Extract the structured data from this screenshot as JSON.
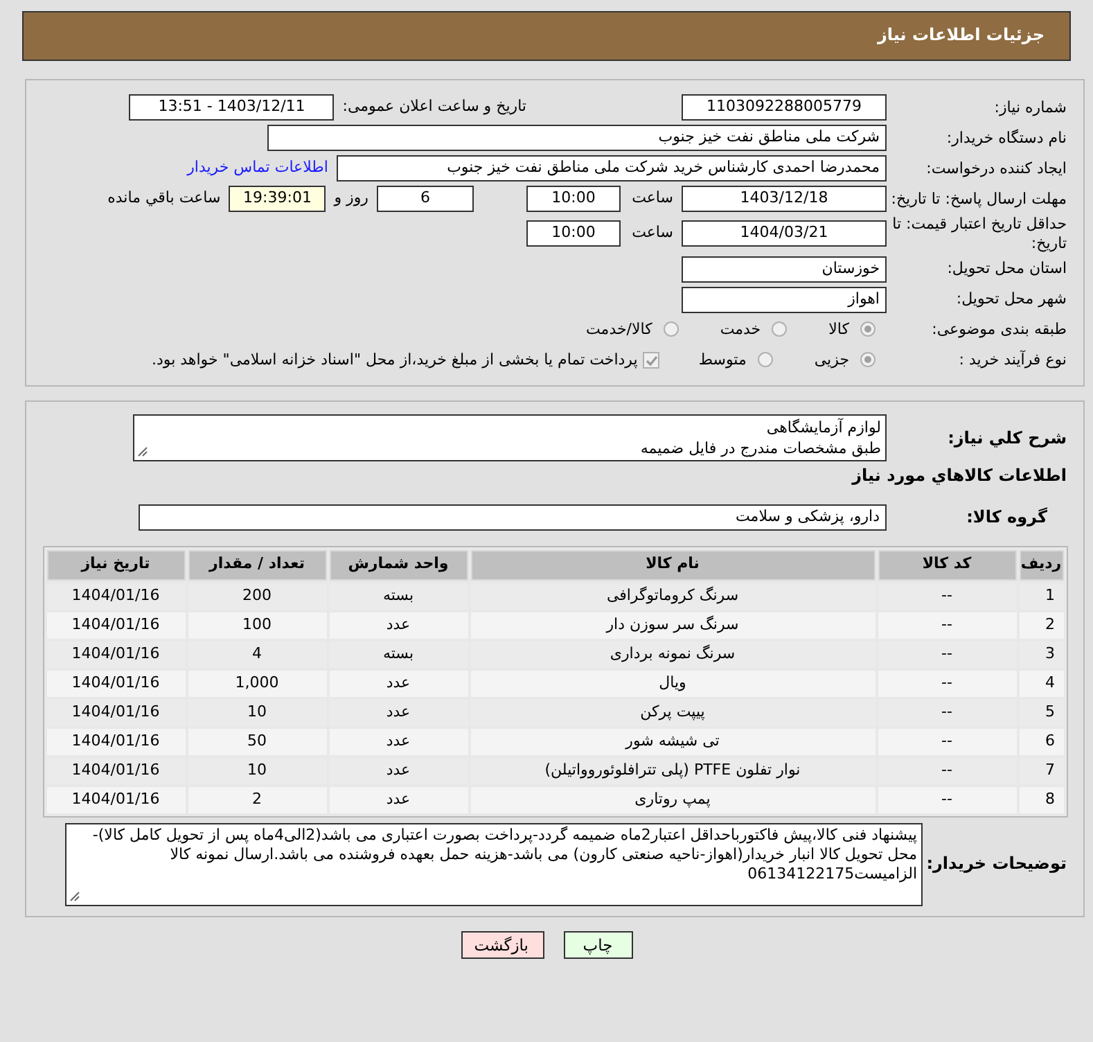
{
  "header": {
    "title": "جزئیات اطلاعات نیاز"
  },
  "details": {
    "need_number": {
      "label": "شماره نیاز:",
      "value": "1103092288005779"
    },
    "announce": {
      "label": "تاریخ و ساعت اعلان عمومی:",
      "value": "1403/12/11 - 13:51"
    },
    "buyer": {
      "label": "نام دستگاه خریدار:",
      "value": "شرکت ملی مناطق نفت خیز جنوب"
    },
    "requester": {
      "label": "ایجاد کننده درخواست:",
      "value": "محمدرضا احمدی  کارشناس خرید  شرکت ملی مناطق نفت خیز جنوب",
      "link": "اطلاعات تماس خریدار"
    },
    "deadline": {
      "label": "مهلت ارسال پاسخ: تا تاریخ:",
      "date": "1403/12/18",
      "time_label": "ساعت",
      "time": "10:00",
      "days": "6",
      "days_label": "روز و",
      "remaining": "19:39:01",
      "remaining_label": "ساعت باقي مانده"
    },
    "validity": {
      "label": "حداقل تاریخ اعتبار قیمت: تا تاریخ:",
      "date": "1404/03/21",
      "time_label": "ساعت",
      "time": "10:00"
    },
    "province": {
      "label": "استان محل تحویل:",
      "value": "خوزستان"
    },
    "city": {
      "label": "شهر محل تحویل:",
      "value": "اهواز"
    },
    "category": {
      "label": "طبقه بندی موضوعی:",
      "options": [
        {
          "label": "کالا",
          "selected": true
        },
        {
          "label": "خدمت",
          "selected": false
        },
        {
          "label": "کالا/خدمت",
          "selected": false
        }
      ]
    },
    "process": {
      "label": "نوع فرآیند خرید :",
      "options": [
        {
          "label": "جزیی",
          "selected": true
        },
        {
          "label": "متوسط",
          "selected": false
        }
      ],
      "treasury": {
        "label": "پرداخت تمام یا بخشی از مبلغ خرید،از محل \"اسناد خزانه اسلامی\" خواهد بود.",
        "checked": true
      }
    }
  },
  "summary": {
    "label": "شرح كلي نياز:",
    "lines": [
      "لوازم آزمايشگاهی",
      "طبق مشخصات مندرج در فايل ضميمه"
    ]
  },
  "goods_title": "اطلاعات كالاهاي مورد نياز",
  "goods_group": {
    "label": "گروه کالا:",
    "value": "دارو، پزشکی و سلامت"
  },
  "table": {
    "columns": [
      "ردیف",
      "کد کالا",
      "نام کالا",
      "واحد شمارش",
      "تعداد / مقدار",
      "تاریخ نیاز"
    ],
    "rows": [
      [
        "1",
        "--",
        "سرنگ کروماتوگرافی",
        "بسته",
        "200",
        "1404/01/16"
      ],
      [
        "2",
        "--",
        "سرنگ سر سوزن دار",
        "عدد",
        "100",
        "1404/01/16"
      ],
      [
        "3",
        "--",
        "سرنگ نمونه برداری",
        "بسته",
        "4",
        "1404/01/16"
      ],
      [
        "4",
        "--",
        "ویال",
        "عدد",
        "1,000",
        "1404/01/16"
      ],
      [
        "5",
        "--",
        "پیپت پرکن",
        "عدد",
        "10",
        "1404/01/16"
      ],
      [
        "6",
        "--",
        "تی شیشه شور",
        "عدد",
        "50",
        "1404/01/16"
      ],
      [
        "7",
        "--",
        "نوار تفلون PTFE (پلی تترافلوئوروواتیلن)",
        "عدد",
        "10",
        "1404/01/16"
      ],
      [
        "8",
        "--",
        "پمپ روتاری",
        "عدد",
        "2",
        "1404/01/16"
      ]
    ]
  },
  "notes": {
    "label": "توضیحات خریدار:",
    "value": "پیشنهاد فنی کالا،پیش فاکتورباحداقل اعتبار2ماه ضمیمه گردد-پرداخت بصورت اعتباری می باشد(2الی4ماه پس از تحویل کامل کالا)- محل تحویل کالا انبار خریدار(اهواز-ناحیه صنعتی کارون) می باشد-هزینه حمل بعهده فروشنده می باشد.ارسال نمونه کالا الزامیست06134122175"
  },
  "buttons": [
    {
      "label": "چاپ",
      "kind": "print"
    },
    {
      "label": "بازگشت",
      "kind": "back"
    }
  ]
}
